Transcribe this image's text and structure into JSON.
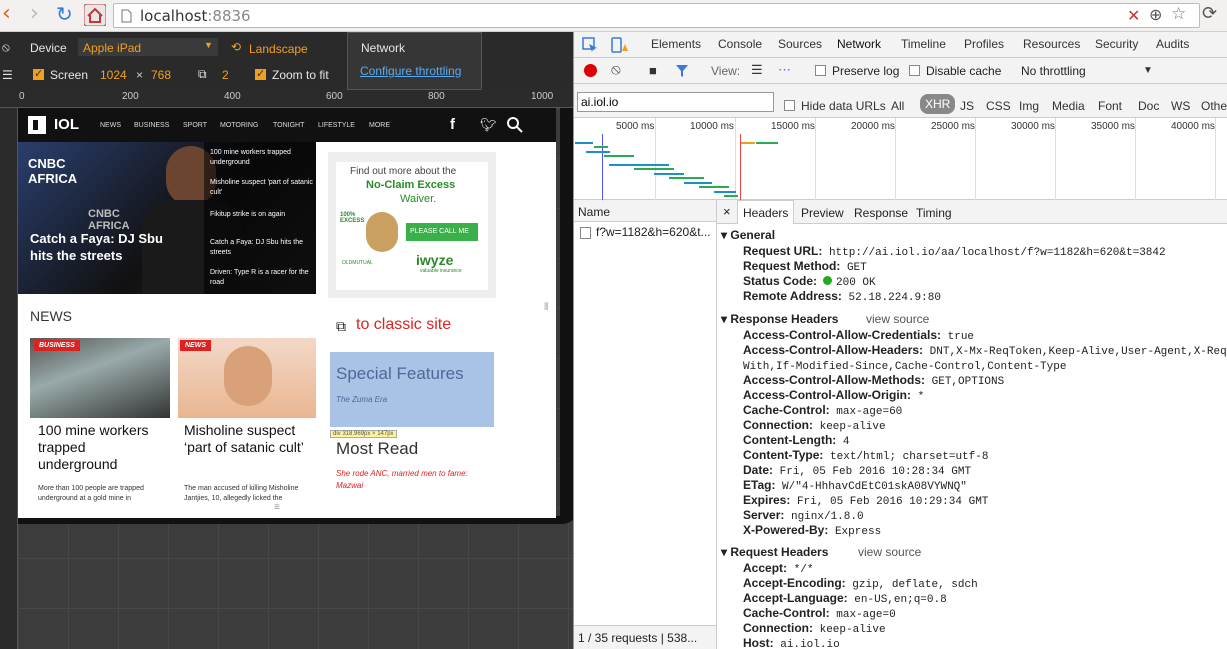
{
  "browser": {
    "url_host": "localhost",
    "url_port": ":8836"
  },
  "device_bar": {
    "device_label": "Device",
    "device_value": "Apple iPad",
    "landscape_label": "Landscape",
    "screen_label": "Screen",
    "screen_w": "1024",
    "times": "×",
    "screen_h": "768",
    "dpr": "2",
    "zoom_label": "Zoom to fit",
    "network_label": "Network",
    "throttling_link": "Configure throttling"
  },
  "ruler": {
    "ticks": [
      "0",
      "200",
      "400",
      "600",
      "800",
      "1000"
    ]
  },
  "site": {
    "logo": "IOL",
    "nav": [
      "NEWS",
      "BUSINESS",
      "SPORT",
      "MOTORING",
      "TONIGHT",
      "LIFESTYLE",
      "MORE"
    ],
    "hero_title": "Catch a Faya: DJ Sbu hits the streets",
    "side_list": [
      "100 mine workers trapped underground",
      "Misholine suspect 'part of satanic cult'",
      "Fikitup strike is on again",
      "Catch a Faya: DJ Sbu hits the streets",
      "Driven: Type R is a racer for the road"
    ],
    "ad_line1": "Find out more about the",
    "ad_line2": "No-Claim Excess",
    "ad_line3": "Waiver.",
    "ad_button": "PLEASE CALL ME",
    "ad_brand": "iwyze",
    "ad_brand_sub": "valuable insurance",
    "ad_brand_left": "OLDMUTUAL",
    "ad_badge": "100% EXCESS",
    "news_heading": "NEWS",
    "card1_tag": "BUSINESS",
    "card1_title": "100 mine workers trapped underground",
    "card1_text": "More than 100 people are trapped underground at a gold mine in",
    "card2_tag": "NEWS",
    "card2_title": "Misholine suspect ‘part of satanic cult’",
    "card2_text": "The man accused of killing Misholine Jantjies, 10, allegedly licked the",
    "classic_link": "to classic site",
    "special_title": "Special Features",
    "special_sub": "The Zuma Era",
    "inspect_badge": "div 318.969px × 147px",
    "most_read": "Most Read",
    "most_read_item": "She rode ANC, married men to fame: Mazwai"
  },
  "devtools": {
    "tabs": [
      "Elements",
      "Console",
      "Sources",
      "Network",
      "Timeline",
      "Profiles",
      "Resources",
      "Security",
      "Audits"
    ],
    "active_tab": "Network",
    "view_label": "View:",
    "preserve_log": "Preserve log",
    "disable_cache": "Disable cache",
    "throttle": "No throttling",
    "filter_value": "ai.iol.io",
    "hide_data_urls": "Hide data URLs",
    "filter_types": [
      "All",
      "XHR",
      "JS",
      "CSS",
      "Img",
      "Media",
      "Font",
      "Doc",
      "WS",
      "Othe"
    ],
    "active_type": "XHR",
    "timeline_labels": [
      "5000 ms",
      "10000 ms",
      "15000 ms",
      "20000 ms",
      "25000 ms",
      "30000 ms",
      "35000 ms",
      "40000 ms"
    ],
    "name_header": "Name",
    "request_name": "f?w=1182&h=620&t...",
    "status_bar": "1 / 35 requests  |  538...",
    "detail_tabs": [
      "Headers",
      "Preview",
      "Response",
      "Timing"
    ],
    "general_title": "General",
    "general": [
      {
        "k": "Request URL:",
        "v": "http://ai.iol.io/aa/localhost/f?w=1182&h=620&t=3842"
      },
      {
        "k": "Request Method:",
        "v": "GET"
      },
      {
        "k": "Status Code:",
        "v": "200 OK"
      },
      {
        "k": "Remote Address:",
        "v": "52.18.224.9:80"
      }
    ],
    "response_title": "Response Headers",
    "view_source": "view source",
    "response": [
      {
        "k": "Access-Control-Allow-Credentials:",
        "v": "true"
      },
      {
        "k": "Access-Control-Allow-Headers:",
        "v": "DNT,X-Mx-ReqToken,Keep-Alive,User-Agent,X-Requ"
      },
      {
        "k": "",
        "v": "With,If-Modified-Since,Cache-Control,Content-Type"
      },
      {
        "k": "Access-Control-Allow-Methods:",
        "v": "GET,OPTIONS"
      },
      {
        "k": "Access-Control-Allow-Origin:",
        "v": "*"
      },
      {
        "k": "Cache-Control:",
        "v": "max-age=60"
      },
      {
        "k": "Connection:",
        "v": "keep-alive"
      },
      {
        "k": "Content-Length:",
        "v": "4"
      },
      {
        "k": "Content-Type:",
        "v": "text/html; charset=utf-8"
      },
      {
        "k": "Date:",
        "v": "Fri, 05 Feb 2016 10:28:34 GMT"
      },
      {
        "k": "ETag:",
        "v": "W/\"4-HhhavCdEtC01skA08VYWNQ\""
      },
      {
        "k": "Expires:",
        "v": "Fri, 05 Feb 2016 10:29:34 GMT"
      },
      {
        "k": "Server:",
        "v": "nginx/1.8.0"
      },
      {
        "k": "X-Powered-By:",
        "v": "Express"
      }
    ],
    "request_title": "Request Headers",
    "request": [
      {
        "k": "Accept:",
        "v": "*/*"
      },
      {
        "k": "Accept-Encoding:",
        "v": "gzip, deflate, sdch"
      },
      {
        "k": "Accept-Language:",
        "v": "en-US,en;q=0.8"
      },
      {
        "k": "Cache-Control:",
        "v": "max-age=0"
      },
      {
        "k": "Connection:",
        "v": "keep-alive"
      },
      {
        "k": "Host:",
        "v": "ai.iol.io"
      }
    ]
  },
  "colors": {
    "accent": "#f0a020",
    "record": "#d00",
    "status_ok": "#2a2",
    "iol_red": "#d22"
  }
}
